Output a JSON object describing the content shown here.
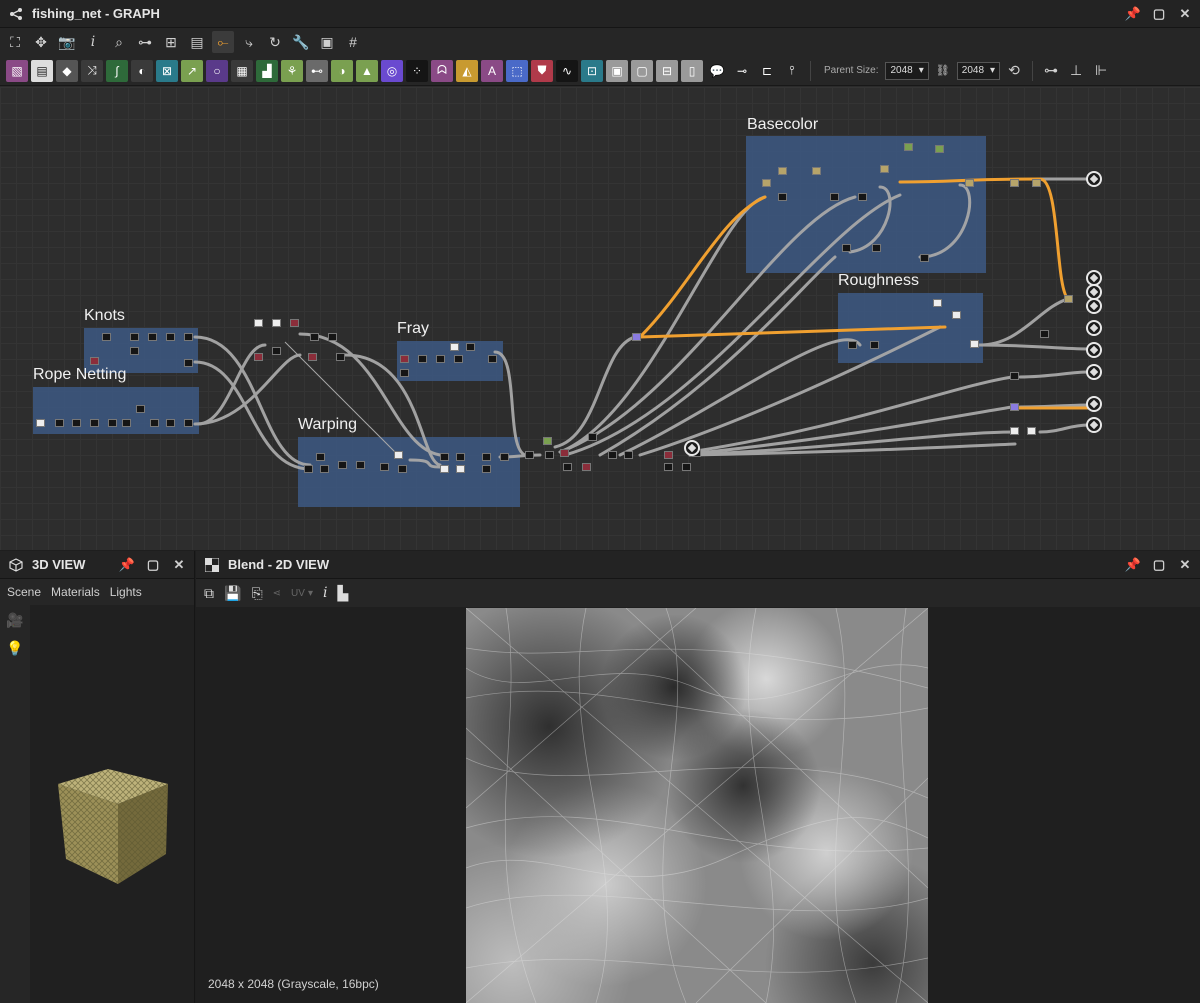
{
  "graph": {
    "title": "fishing_net - GRAPH",
    "parent_size_label": "Parent Size:",
    "size_value_1": "2048",
    "size_value_2": "2048",
    "frames": {
      "basecolor": "Basecolor",
      "roughness": "Roughness",
      "knots": "Knots",
      "rope_netting": "Rope Netting",
      "fray": "Fray",
      "warping": "Warping"
    },
    "colors": {
      "frame": "#3d5c8a",
      "wire": "#a8a8a8",
      "wire_highlight": "#f0a030",
      "canvas_bg": "#2d2d2d"
    }
  },
  "view3d": {
    "title": "3D VIEW",
    "tabs": [
      "Scene",
      "Materials",
      "Lights"
    ]
  },
  "view2d": {
    "title": "Blend - 2D VIEW",
    "uv_label": "UV",
    "status": "2048 x 2048 (Grayscale, 16bpc)"
  }
}
